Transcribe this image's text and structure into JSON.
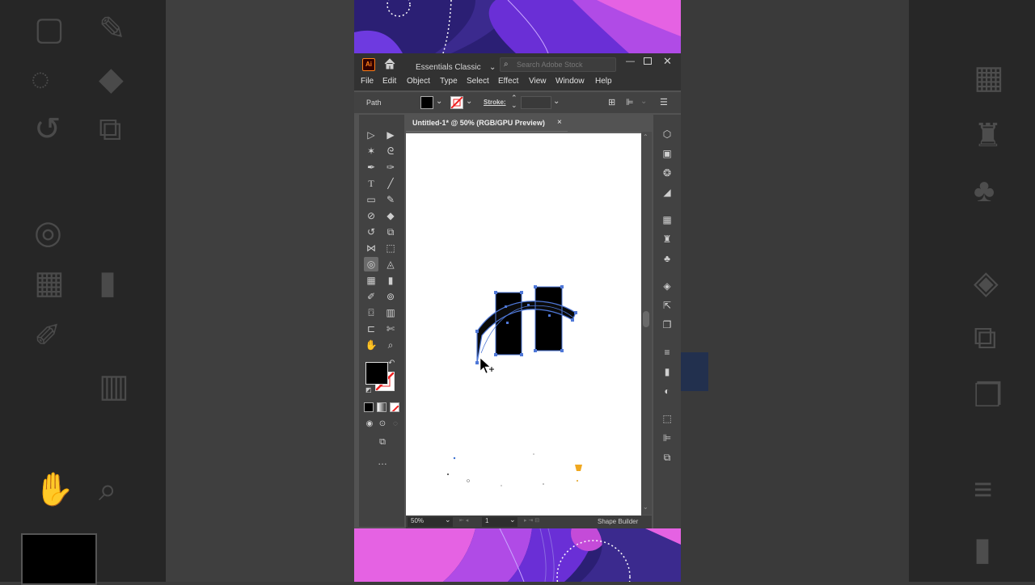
{
  "app": {
    "logo": "Ai",
    "workspace": "Essentials Classic",
    "search_placeholder": "Search Adobe Stock",
    "menu": [
      "File",
      "Edit",
      "Object",
      "Type",
      "Select",
      "Effect",
      "View",
      "Window",
      "Help"
    ]
  },
  "control_bar": {
    "selection_label": "Path",
    "stroke_label": "Stroke:"
  },
  "document": {
    "tab_title": "Untitled-1* @ 50% (RGB/GPU Preview)",
    "close_symbol": "×"
  },
  "status_bar": {
    "zoom": "50%",
    "artboard_number": "1",
    "active_tool": "Shape Builder"
  },
  "tools_panel": {
    "active_tool": "shape-builder-tool",
    "more_label": "…"
  },
  "colors": {
    "selection": "#4f78d8",
    "fill": "#000000",
    "ui_dark": "#323232",
    "ui_mid": "#535353",
    "accent_pink": "#e85ce0",
    "accent_purple": "#7a2fd8"
  }
}
